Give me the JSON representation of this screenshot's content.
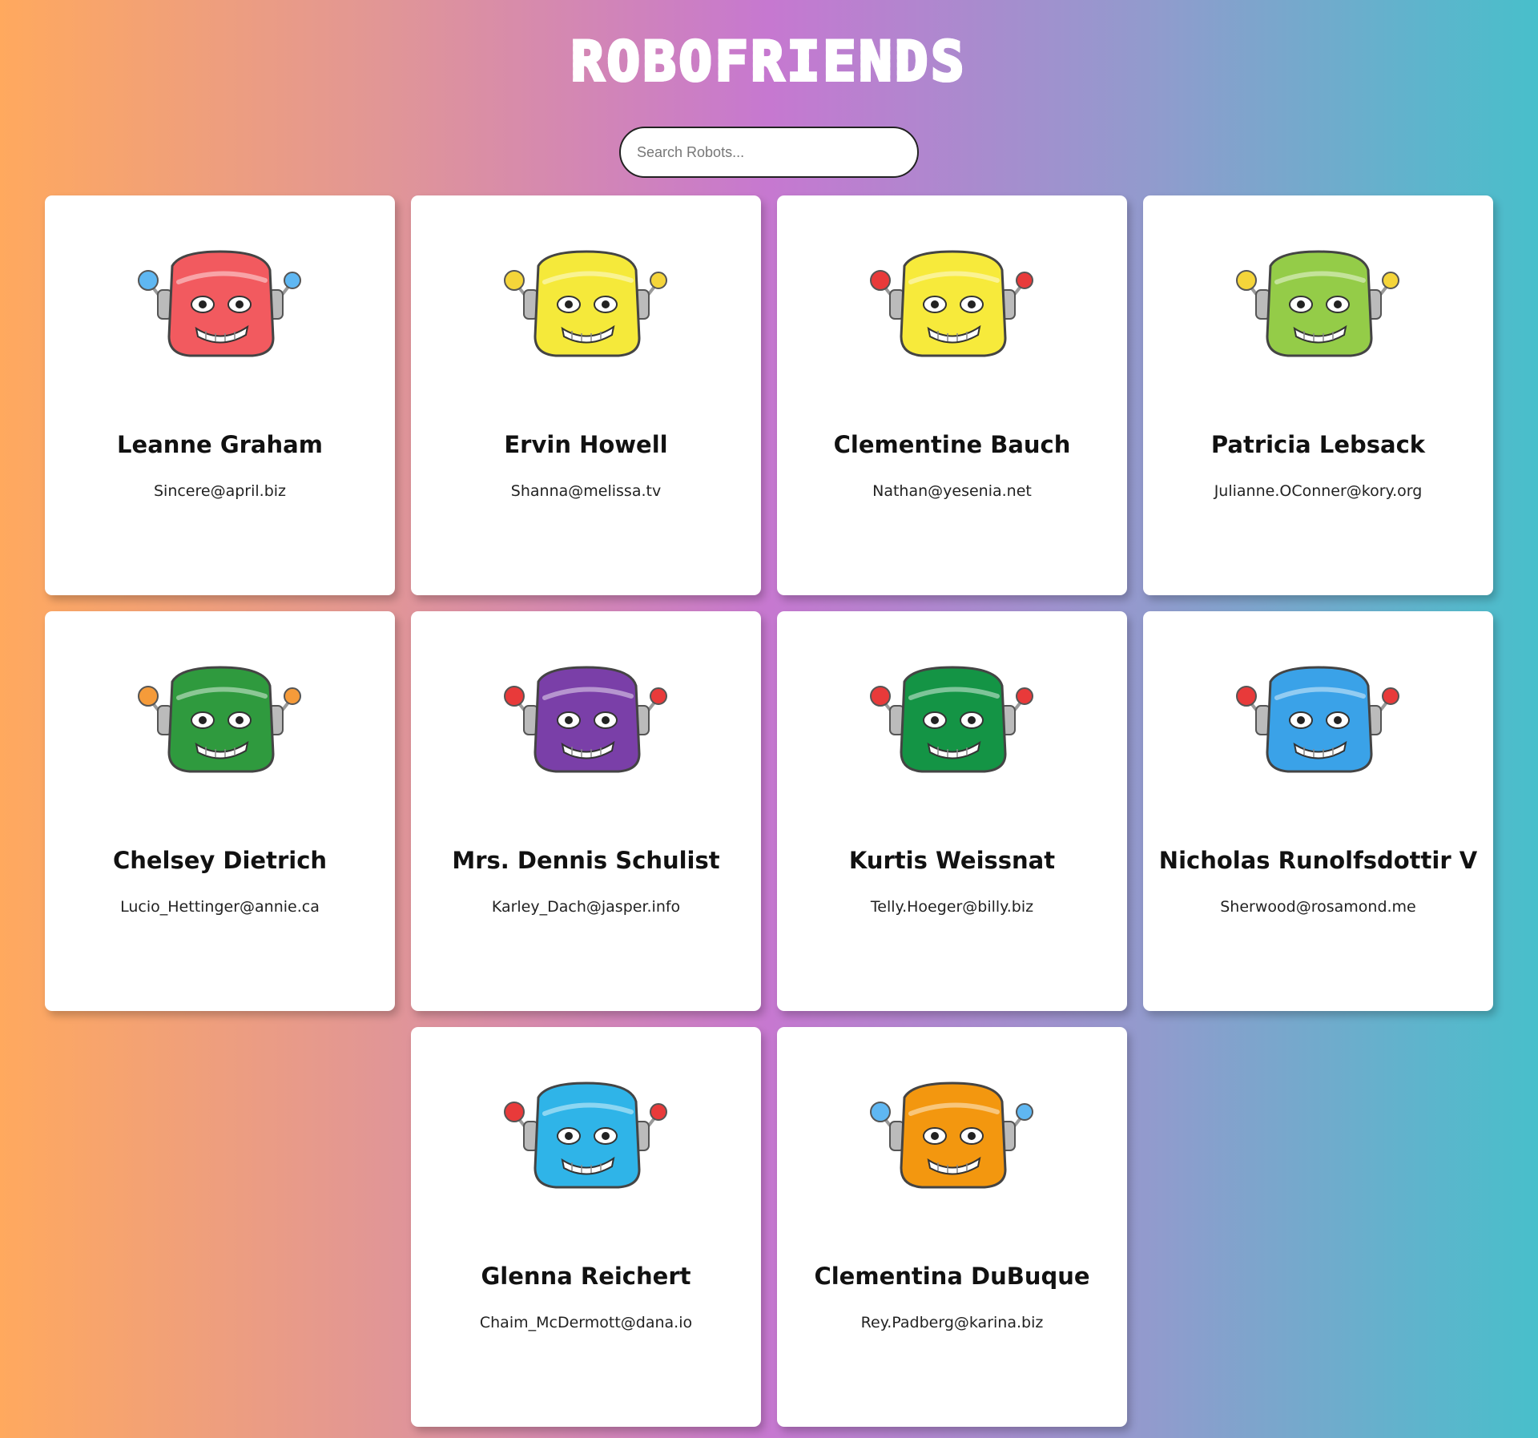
{
  "header": {
    "title": "ROBOFRIENDS"
  },
  "search": {
    "placeholder": "Search Robots...",
    "value": ""
  },
  "robots": [
    {
      "name": "Leanne Graham",
      "email": "Sincere@april.biz",
      "color": "#f25a5f",
      "accent": "#5fb7f2"
    },
    {
      "name": "Ervin Howell",
      "email": "Shanna@melissa.tv",
      "color": "#f5e93a",
      "accent": "#f5d53a"
    },
    {
      "name": "Clementine Bauch",
      "email": "Nathan@yesenia.net",
      "color": "#f7ea3b",
      "accent": "#e83a3a"
    },
    {
      "name": "Patricia Lebsack",
      "email": "Julianne.OConner@kory.org",
      "color": "#94cc48",
      "accent": "#f5d53a"
    },
    {
      "name": "Chelsey Dietrich",
      "email": "Lucio_Hettinger@annie.ca",
      "color": "#2f9a3e",
      "accent": "#f59b3a"
    },
    {
      "name": "Mrs. Dennis Schulist",
      "email": "Karley_Dach@jasper.info",
      "color": "#7a3fa8",
      "accent": "#e83a3a"
    },
    {
      "name": "Kurtis Weissnat",
      "email": "Telly.Hoeger@billy.biz",
      "color": "#149445",
      "accent": "#e83a3a"
    },
    {
      "name": "Nicholas Runolfsdottir V",
      "email": "Sherwood@rosamond.me",
      "color": "#3aa2e8",
      "accent": "#e83a3a"
    },
    {
      "name": "Glenna Reichert",
      "email": "Chaim_McDermott@dana.io",
      "color": "#2fb4e8",
      "accent": "#e83a3a"
    },
    {
      "name": "Clementina DuBuque",
      "email": "Rey.Padberg@karina.biz",
      "color": "#f3970f",
      "accent": "#5fb7f2"
    }
  ]
}
